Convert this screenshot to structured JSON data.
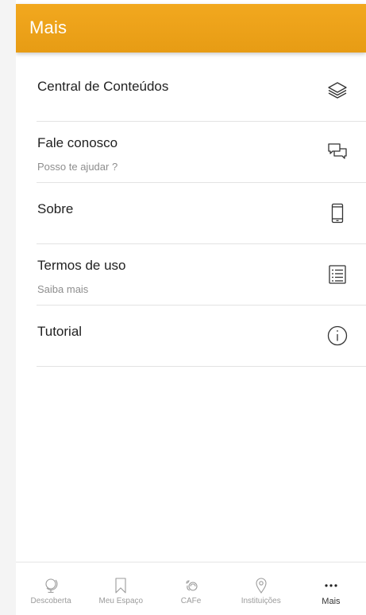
{
  "header": {
    "title": "Mais"
  },
  "menu": {
    "items": [
      {
        "title": "Central de Conteúdos",
        "subtitle": "",
        "icon": "layers-icon"
      },
      {
        "title": "Fale conosco",
        "subtitle": "Posso te ajudar ?",
        "icon": "chat-bubbles-icon"
      },
      {
        "title": "Sobre",
        "subtitle": "",
        "icon": "smartphone-icon"
      },
      {
        "title": "Termos de uso",
        "subtitle": "Saiba mais",
        "icon": "list-document-icon"
      },
      {
        "title": "Tutorial",
        "subtitle": "",
        "icon": "info-circle-icon"
      }
    ]
  },
  "tabbar": {
    "tabs": [
      {
        "label": "Descoberta",
        "icon": "globe-icon"
      },
      {
        "label": "Meu Espaço",
        "icon": "bookmark-icon"
      },
      {
        "label": "CAFe",
        "icon": "cafe-icon"
      },
      {
        "label": "Instituições",
        "icon": "location-pin-icon"
      },
      {
        "label": "Mais",
        "icon": "more-dots-icon",
        "active": true
      }
    ]
  },
  "colors": {
    "header": "#f2a81f",
    "text": "#222222",
    "subtext": "#8e8e8e",
    "tab_inactive": "#9b9b9b"
  }
}
